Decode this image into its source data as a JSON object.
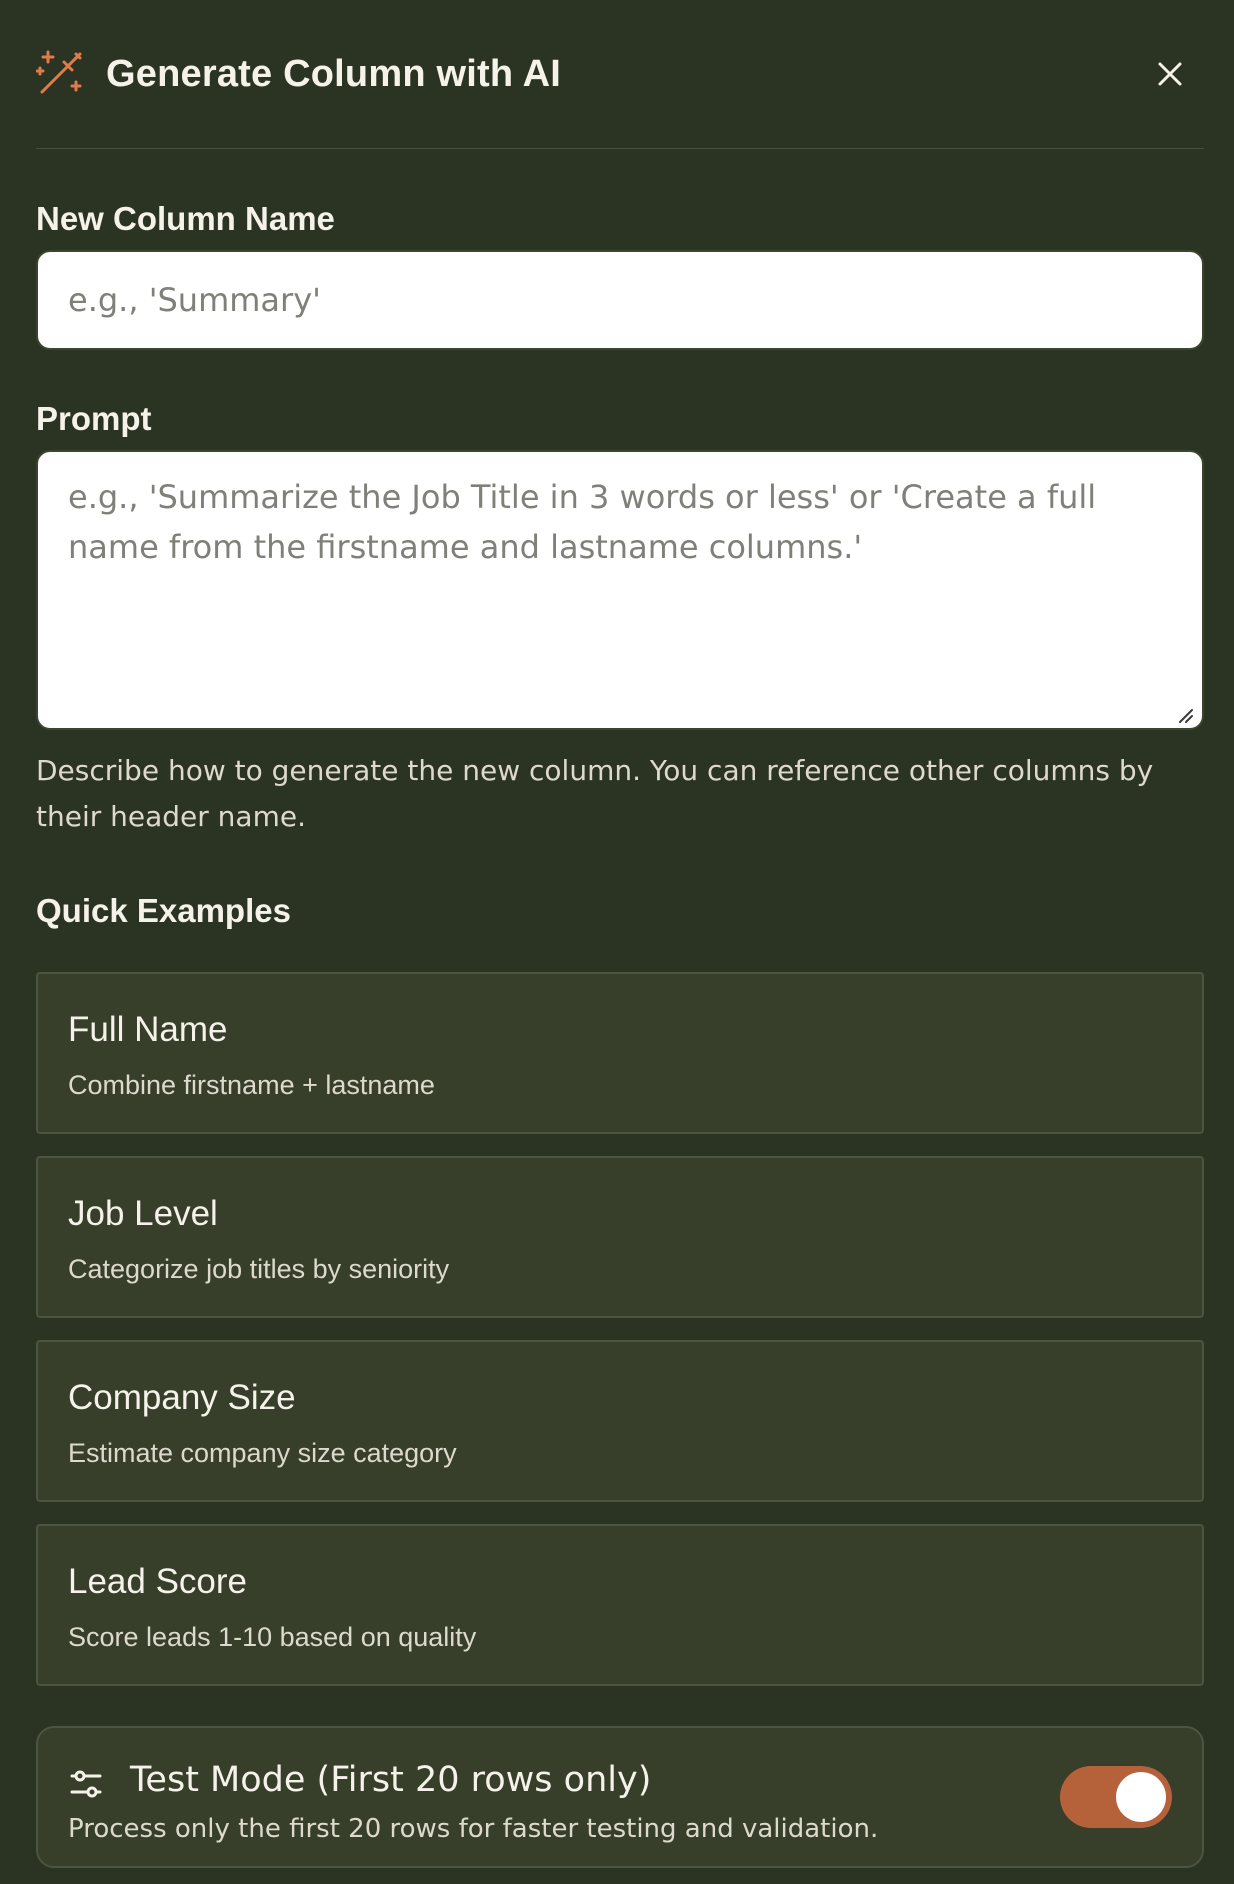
{
  "header": {
    "title": "Generate Column with AI"
  },
  "column_name": {
    "label": "New Column Name",
    "value": "",
    "placeholder": "e.g., 'Summary'"
  },
  "prompt": {
    "label": "Prompt",
    "value": "",
    "placeholder": "e.g., 'Summarize the Job Title in 3 words or less' or 'Create a full name from the firstname and lastname columns.'",
    "help_text": "Describe how to generate the new column. You can reference other columns by their header name."
  },
  "quick_examples": {
    "label": "Quick Examples",
    "items": [
      {
        "title": "Full Name",
        "description": "Combine firstname + lastname"
      },
      {
        "title": "Job Level",
        "description": "Categorize job titles by seniority"
      },
      {
        "title": "Company Size",
        "description": "Estimate company size category"
      },
      {
        "title": "Lead Score",
        "description": "Score leads 1-10 based on quality"
      }
    ]
  },
  "test_mode": {
    "title": "Test Mode (First 20 rows only)",
    "description": "Process only the first 20 rows for faster testing and validation.",
    "enabled": true
  },
  "colors": {
    "background": "#2b3322",
    "accent": "#b5623a",
    "card": "#373f2b"
  },
  "icons": {
    "header": "magic-wand-icon",
    "close": "close-icon",
    "test_mode": "sliders-icon"
  }
}
